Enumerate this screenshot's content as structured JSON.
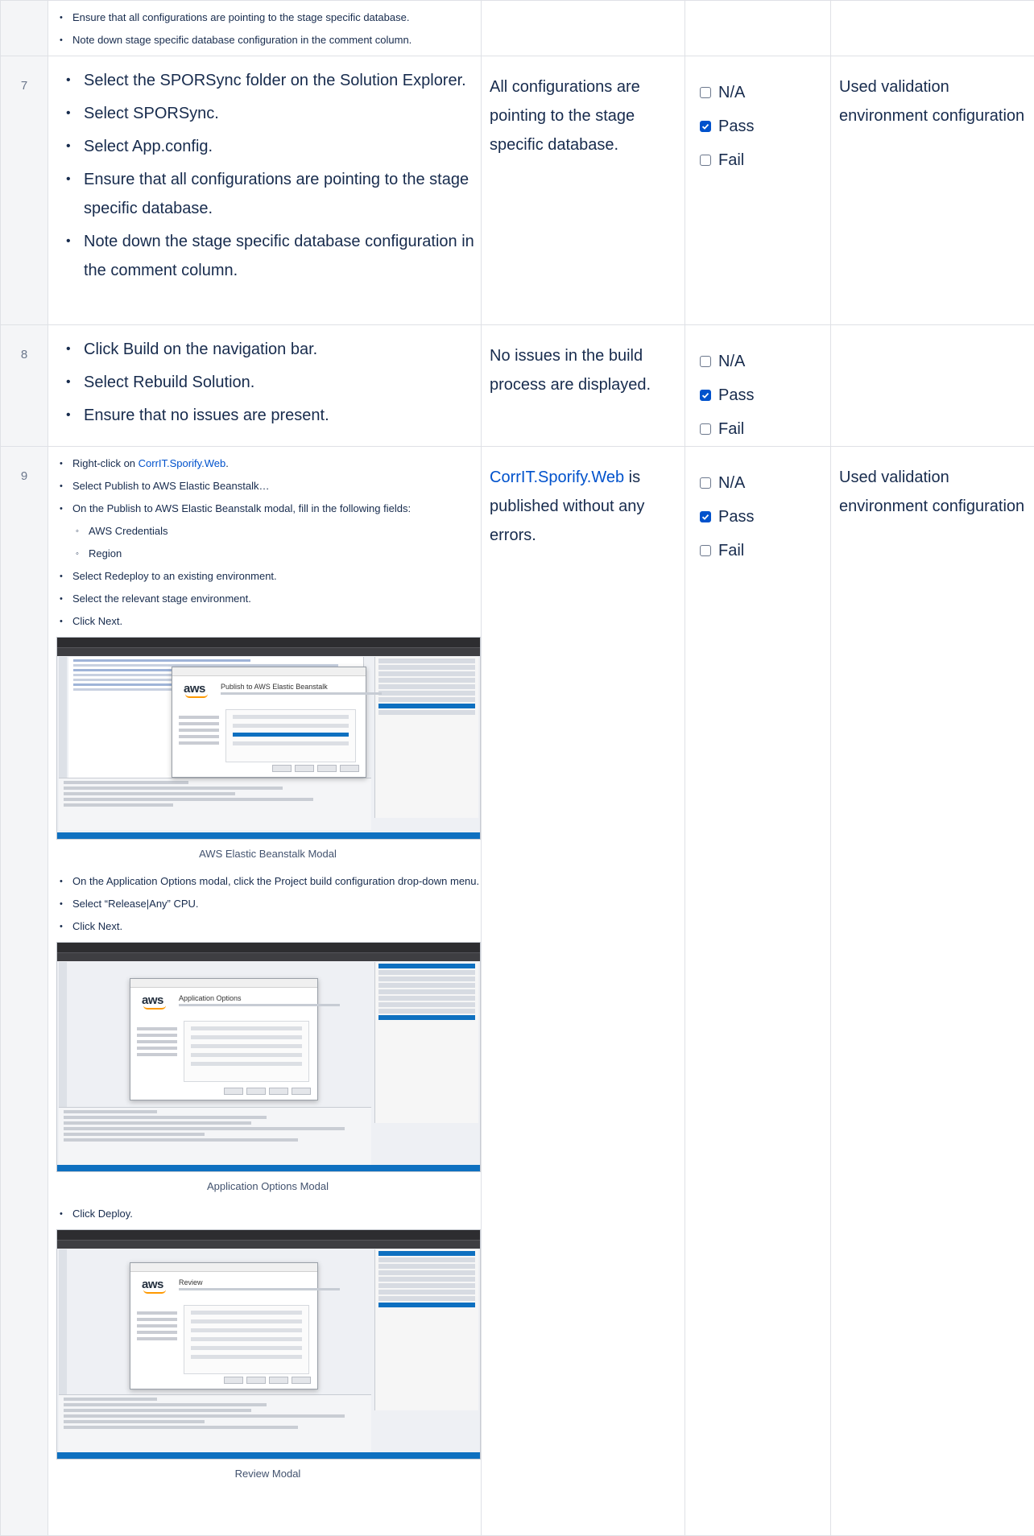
{
  "rows": [
    {
      "number": "",
      "steps": [
        "Ensure that all configurations are pointing to the stage specific database.",
        "Note down stage specific database configuration in the comment column."
      ]
    },
    {
      "number": "7",
      "steps": [
        "Select the SPORSync folder on the Solution Explorer.",
        "Select SPORSync.",
        "Select App.config.",
        "Ensure that all configurations are pointing to the stage specific database.",
        "Note down the stage specific database configuration in the comment column."
      ],
      "expected": "All configurations are pointing to the stage specific database.",
      "status": [
        "N/A",
        "Pass",
        "Fail"
      ],
      "status_selected": "Pass",
      "comment": "Used validation environment configuration"
    },
    {
      "number": "8",
      "steps": [
        "Click Build on the navigation bar.",
        "Select Rebuild Solution.",
        "Ensure that no issues are present."
      ],
      "expected": "No issues in the build process are displayed.",
      "status": [
        "N/A",
        "Pass",
        "Fail"
      ],
      "status_selected": "Pass",
      "comment": ""
    },
    {
      "number": "9",
      "steps_block1": {
        "first_prefix": "Right-click on ",
        "first_link": "CorrIT.Sporify.Web",
        "first_suffix": ".",
        "items": [
          "Select Publish to AWS Elastic Beanstalk…",
          "On the Publish to AWS Elastic Beanstalk modal, fill in the following fields:"
        ],
        "sub_items": [
          "AWS Credentials",
          "Region"
        ],
        "items_after": [
          "Select Redeploy to an existing environment.",
          "Select the relevant stage environment.",
          "Click Next."
        ]
      },
      "figure1": {
        "caption": "AWS Elastic Beanstalk Modal",
        "aws_logo": "aws",
        "dialog_heading": "Publish to AWS Elastic Beanstalk"
      },
      "steps_block2": [
        "On the Application Options modal, click the Project build configuration drop-down menu.",
        "Select “Release|Any” CPU.",
        "Click Next."
      ],
      "figure2": {
        "caption": "Application Options Modal",
        "aws_logo": "aws",
        "dialog_heading": "Application Options"
      },
      "steps_block3": [
        "Click Deploy."
      ],
      "figure3": {
        "caption": "Review Modal",
        "aws_logo": "aws",
        "dialog_heading": "Review"
      },
      "expected_link": "CorrIT.Sporify.Web",
      "expected_rest": " is published without any errors.",
      "status": [
        "N/A",
        "Pass",
        "Fail"
      ],
      "status_selected": "Pass",
      "comment": "Used validation environment configuration"
    }
  ],
  "colors": {
    "link": "#0052cc",
    "checkbox_checked": "#0052cc",
    "border": "#dfe1e6",
    "number_bg": "#f4f5f7"
  }
}
